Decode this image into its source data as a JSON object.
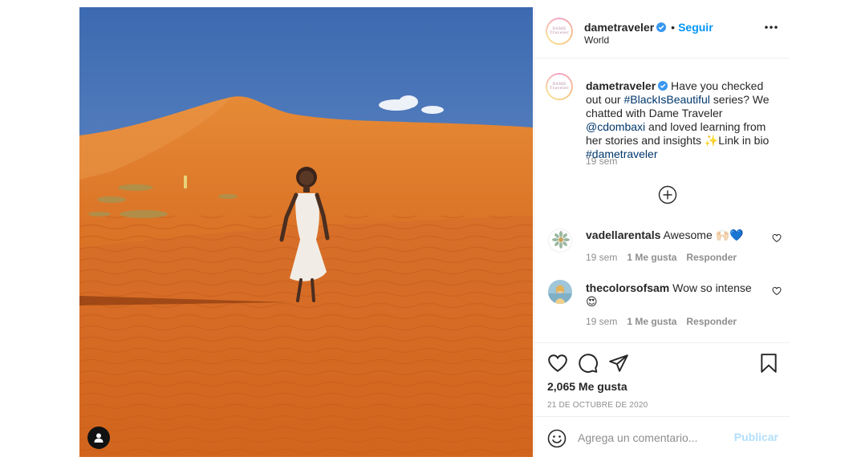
{
  "post": {
    "author": "dametraveler",
    "follow_separator": "•",
    "follow_label": "Seguir",
    "location": "World",
    "avatar_text_top": "DAME",
    "avatar_text_bottom": "Traveler"
  },
  "caption": {
    "author": "dametraveler",
    "part1": " Have you checked out our ",
    "hashtag1": "#BlackIsBeautiful",
    "part2": " series? We chatted with Dame Traveler ",
    "mention": "@cdombaxi",
    "part3": " and loved learning from her stories and insights ",
    "sparkle": "✨",
    "part4": "Link in bio ",
    "hashtag2": "#dametraveler",
    "time": "19 sem"
  },
  "comments": [
    {
      "username": "vadellarentals",
      "text": " Awesome 🙌🏻💙",
      "time": "19 sem",
      "likes": "1 Me gusta",
      "reply": "Responder"
    },
    {
      "username": "thecolorsofsam",
      "text": " Wow so intense 😍",
      "time": "19 sem",
      "likes": "1 Me gusta",
      "reply": "Responder"
    }
  ],
  "actions": {
    "likes_count": "2,065 Me gusta",
    "date": "21 DE OCTUBRE DE 2020"
  },
  "comment_bar": {
    "placeholder": "Agrega un comentario...",
    "publish_label": "Publicar"
  },
  "colors": {
    "accent": "#0095f6",
    "link": "#00376b",
    "muted": "#8e8e8e",
    "publish_disabled": "#b2dffc",
    "sand": "#d9732a",
    "sky": "#4f7dc0"
  },
  "icons": [
    "verified-badge-icon",
    "more-options-icon",
    "load-more-icon",
    "heart-icon",
    "comment-icon",
    "share-icon",
    "bookmark-icon",
    "emoji-icon",
    "user-tag-icon"
  ]
}
